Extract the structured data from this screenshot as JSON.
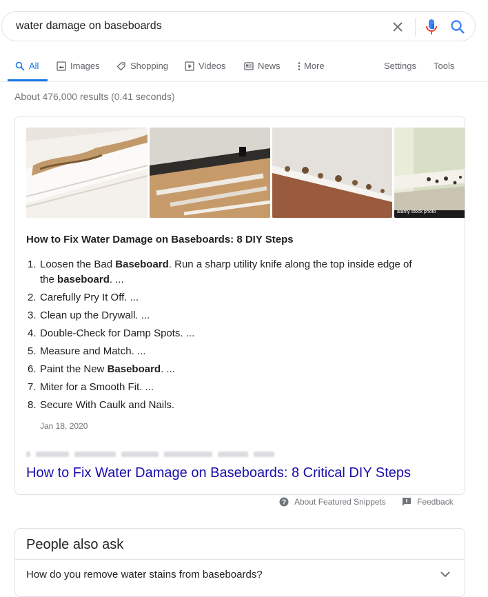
{
  "search": {
    "query": "water damage on baseboards"
  },
  "tabs": {
    "all": "All",
    "images": "Images",
    "shopping": "Shopping",
    "videos": "Videos",
    "news": "News",
    "more": "More",
    "settings": "Settings",
    "tools": "Tools"
  },
  "results_stats": "About 476,000 results (0.41 seconds)",
  "snippet": {
    "image_watermark": "alamy stock photo",
    "title": "How to Fix Water Damage on Baseboards: 8 DIY Steps",
    "steps": [
      {
        "num": "1.",
        "pre": "Loosen the Bad ",
        "bold": "Baseboard",
        "post": ". Run a sharp utility knife along the top inside edge of",
        "pre2": "the ",
        "bold2": "baseboard",
        "post2": ". ..."
      },
      {
        "num": "2.",
        "text": "Carefully Pry It Off. ..."
      },
      {
        "num": "3.",
        "text": "Clean up the Drywall. ..."
      },
      {
        "num": "4.",
        "text": "Double-Check for Damp Spots. ..."
      },
      {
        "num": "5.",
        "text": "Measure and Match. ..."
      },
      {
        "num": "6.",
        "pre": "Paint the New ",
        "bold": "Baseboard",
        "post": ". ..."
      },
      {
        "num": "7.",
        "text": "Miter for a Smooth Fit. ..."
      },
      {
        "num": "8.",
        "text": "Secure With Caulk and Nails."
      }
    ],
    "date": "Jan 18, 2020",
    "link_text": "How to Fix Water Damage on Baseboards: 8 Critical DIY Steps"
  },
  "feedback": {
    "about_label": "About Featured Snippets",
    "feedback_label": "Feedback"
  },
  "people_also_ask": {
    "title": "People also ask",
    "questions": [
      "How do you remove water stains from baseboards?"
    ]
  },
  "colors": {
    "accent": "#1a73e8",
    "link": "#1a0dab",
    "muted": "#70757a"
  },
  "icons": [
    "clear-icon",
    "mic-icon",
    "search-icon",
    "images-icon",
    "shopping-tag-icon",
    "videos-icon",
    "news-icon",
    "more-dots-icon",
    "help-icon",
    "feedback-icon",
    "chevron-down-icon"
  ]
}
